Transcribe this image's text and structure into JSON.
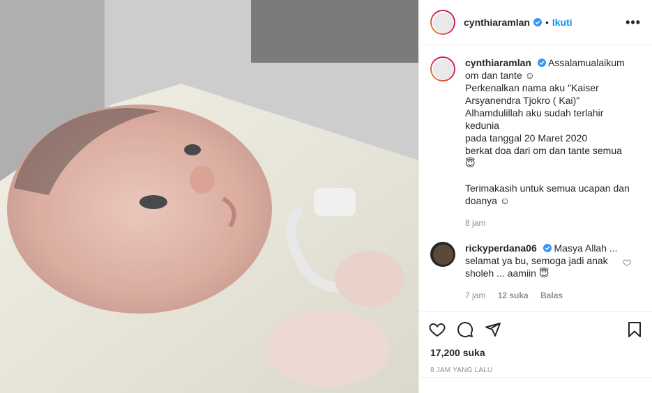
{
  "post": {
    "username": "cynthiaramlan",
    "follow_label": "Ikuti",
    "more_label": "•••",
    "dot": "•"
  },
  "caption": {
    "username": "cynthiaramlan",
    "lines": [
      "Assalamualaikum",
      "om dan tante ☺",
      "Perkenalkan nama aku \"Kaiser",
      "Arsyanendra Tjokro ( Kai)\"",
      "Alhamdulillah aku sudah terlahir",
      "kedunia",
      "pada tanggal 20 Maret 2020",
      "berkat doa dari om dan tante semua",
      "😇",
      "",
      "Terimakasih untuk semua ucapan dan",
      "doanya ☺"
    ],
    "time": "8 jam"
  },
  "comment": {
    "username": "rickyperdana06",
    "text_first": "Masya Allah ...",
    "text_lines": [
      "selamat ya bu, semoga jadi anak",
      "sholeh ... aamiin 😇"
    ],
    "time": "7 jam",
    "likes": "12 suka",
    "reply": "Balas"
  },
  "footer": {
    "likes": "17,200 suka",
    "posted": "8 JAM YANG LALU"
  },
  "colors": {
    "accent": "#0095f6",
    "muted": "#8e8e8e",
    "border": "#efefef"
  },
  "icons": [
    "heart-icon",
    "comment-icon",
    "share-icon",
    "bookmark-icon",
    "verified-icon",
    "more-icon"
  ]
}
